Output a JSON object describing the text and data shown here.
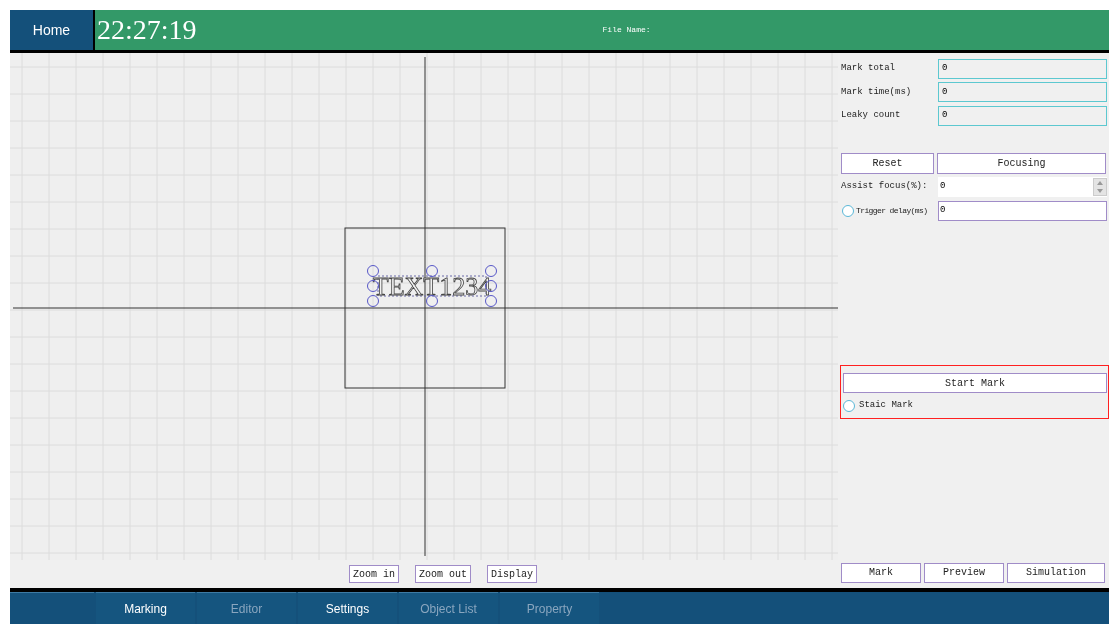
{
  "header": {
    "home_button": "Home",
    "clock": "22:27:19",
    "file_name_label": "File Name:"
  },
  "canvas": {
    "object_text": "TEXT1234"
  },
  "canvas_buttons": [
    "Zoom in",
    "Zoom out",
    "Display"
  ],
  "stats": [
    {
      "label": "Mark total",
      "value": "0"
    },
    {
      "label": "Mark time(ms)",
      "value": "0"
    },
    {
      "label": "Leaky count",
      "value": "0"
    }
  ],
  "reset_button": "Reset",
  "focusing_button": "Focusing",
  "assist_focus": {
    "label": "Assist focus(%):",
    "value": "0"
  },
  "trigger_delay": {
    "label": "Trigger delay(ms)",
    "value": "0",
    "checked": false
  },
  "start_mark": {
    "button": "Start Mark",
    "static_label": "Staic Mark",
    "static_checked": false
  },
  "action_buttons": [
    "Mark",
    "Preview",
    "Simulation"
  ],
  "tabs": [
    {
      "label": "Marking",
      "disabled": false
    },
    {
      "label": "Editor",
      "disabled": true
    },
    {
      "label": "Settings",
      "disabled": false
    },
    {
      "label": "Object List",
      "disabled": true
    },
    {
      "label": "Property",
      "disabled": true
    }
  ]
}
